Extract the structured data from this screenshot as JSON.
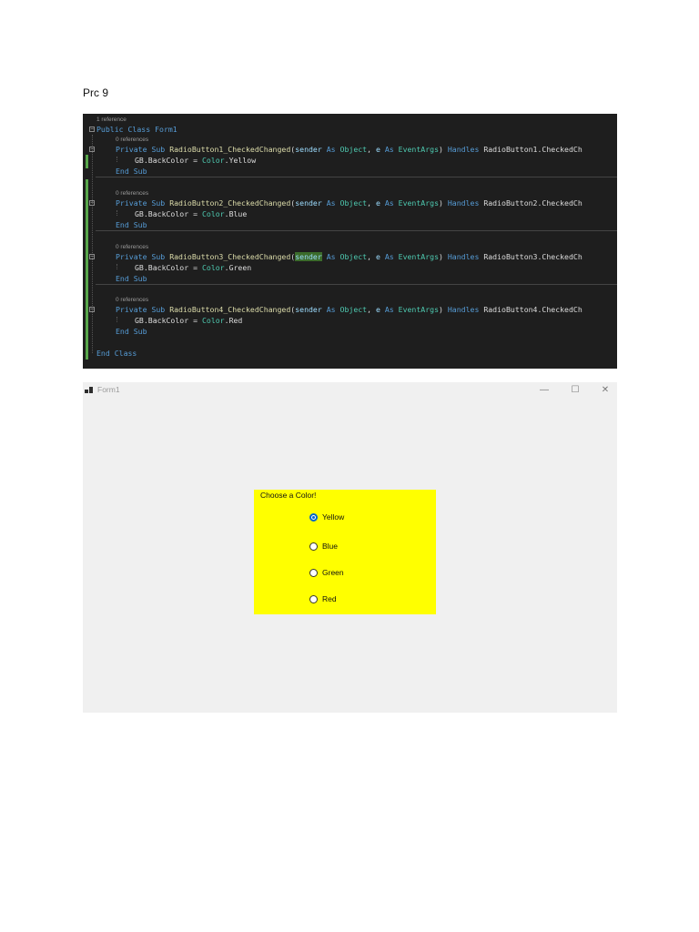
{
  "document": {
    "title": "Prc 9"
  },
  "code": {
    "class_refs": "1 reference",
    "class_decl": "Public Class Form1",
    "subs": [
      {
        "refs": "0 references",
        "name": "RadioButton1_CheckedChanged",
        "handles": "RadioButton1.CheckedCh",
        "color": "Yellow"
      },
      {
        "refs": "0 references",
        "name": "RadioButton2_CheckedChanged",
        "handles": "RadioButton2.CheckedCh",
        "color": "Blue"
      },
      {
        "refs": "0 references",
        "name": "RadioButton3_CheckedChanged",
        "handles": "RadioButton3.CheckedCh",
        "color": "Green"
      },
      {
        "refs": "0 references",
        "name": "RadioButton4_CheckedChanged",
        "handles": "RadioButton4.CheckedCh",
        "color": "Red"
      }
    ],
    "tokens": {
      "private": "Private",
      "sub": "Sub",
      "sender": "sender",
      "as": "As",
      "object": "Object",
      "e": "e",
      "eventargs": "EventArgs",
      "handles": "Handles",
      "assign_target": "GB.BackColor",
      "equals": "=",
      "color_type": "Color",
      "end_sub": "End Sub",
      "end_class": "End Class"
    }
  },
  "form": {
    "window_title": "Form1",
    "controls": {
      "minimize": "—",
      "maximize": "☐",
      "close": "✕"
    },
    "group_box": {
      "caption": "Choose a Color!",
      "background": "#ffff00"
    },
    "radios": [
      {
        "label": "Yellow",
        "checked": true
      },
      {
        "label": "Blue",
        "checked": false
      },
      {
        "label": "Green",
        "checked": false
      },
      {
        "label": "Red",
        "checked": false
      }
    ]
  }
}
